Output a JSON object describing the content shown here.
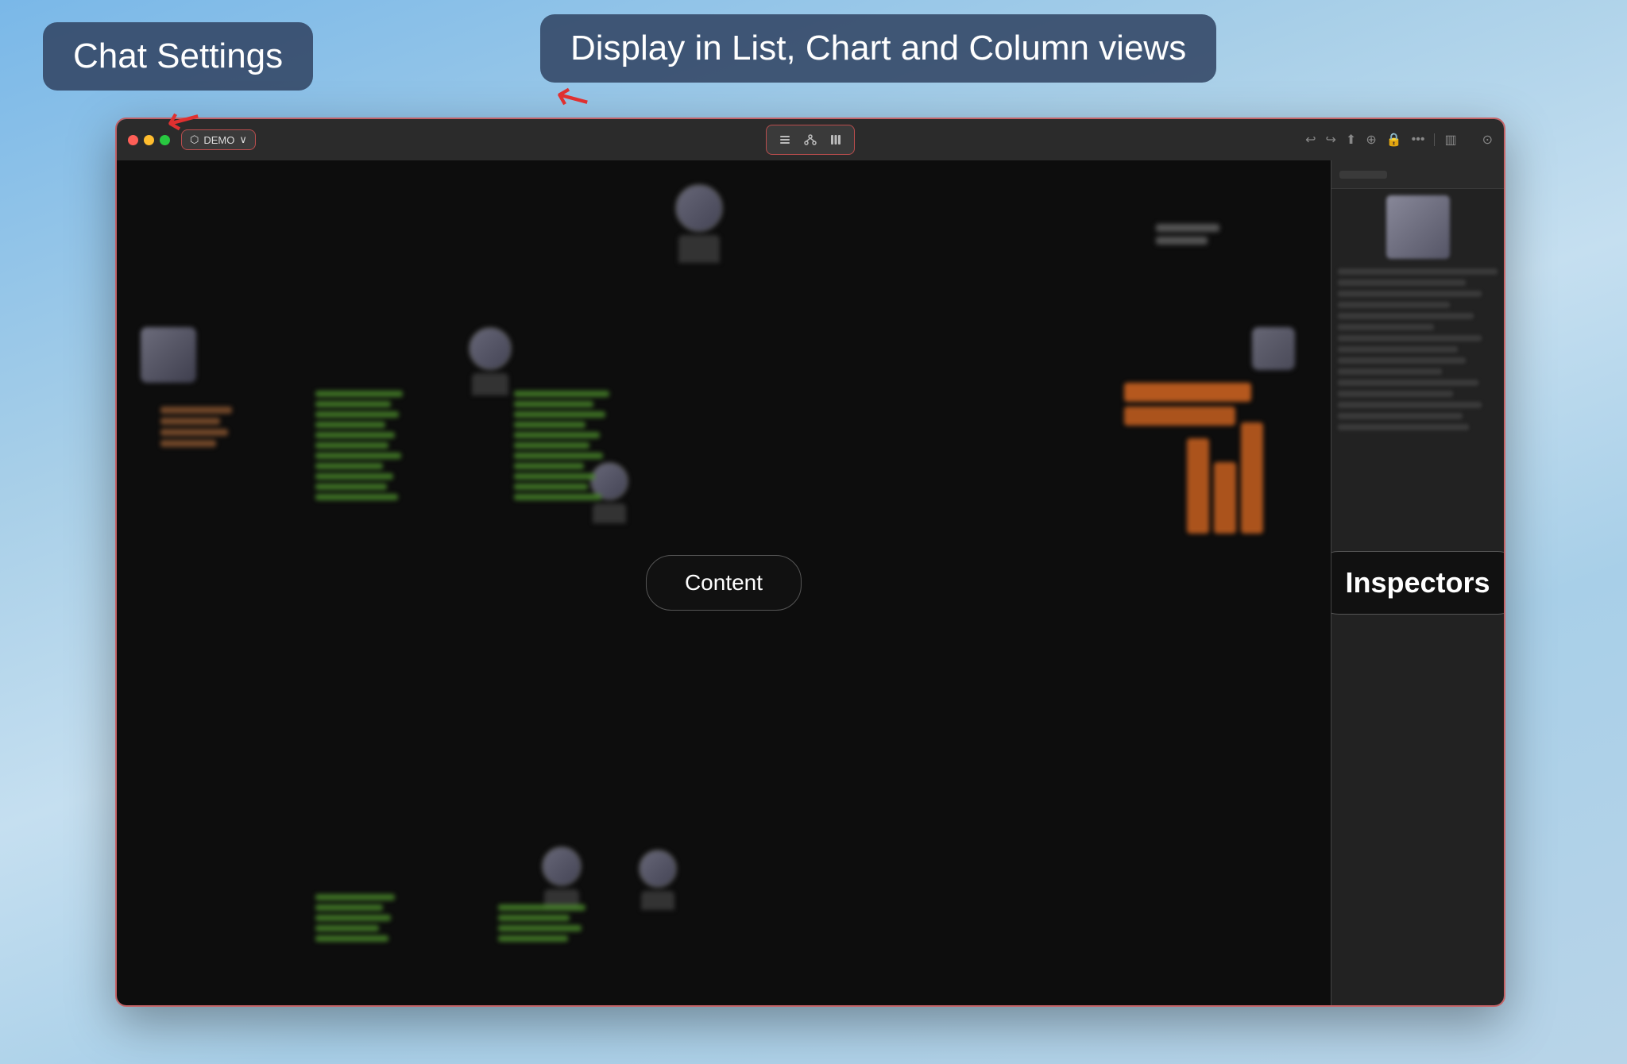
{
  "tooltips": {
    "chat_settings": "Chat Settings",
    "display_views": "Display in List, Chart and Column views"
  },
  "titlebar": {
    "project_name": "DEMO",
    "project_icon": "⬡"
  },
  "toolbar": {
    "list_icon": "≡",
    "chart_icon": "⋮",
    "column_icon": "⊞",
    "undo_icon": "↩",
    "redo_icon": "↪",
    "share_icon": "↗",
    "settings_icon": "⊕",
    "lock_icon": "🔒",
    "more_icon": "•••",
    "sidebar_icon": "▥",
    "clock_icon": "⊙"
  },
  "canvas": {
    "content_label": "Content"
  },
  "inspector": {
    "label": "Inspectors"
  }
}
